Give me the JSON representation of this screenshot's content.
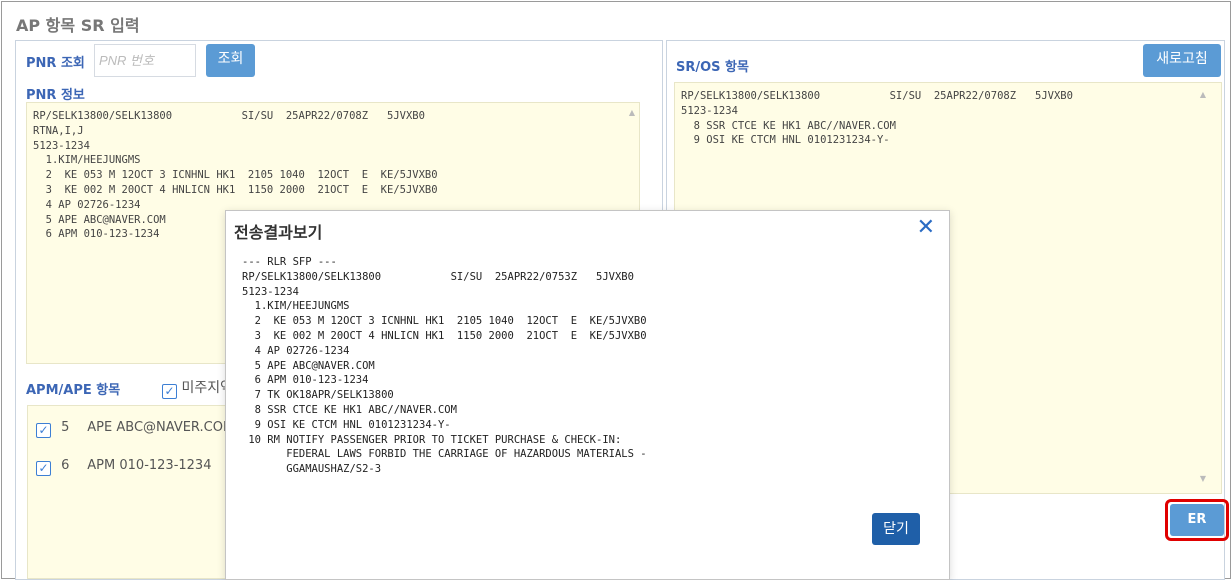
{
  "window": {
    "title": "AP 항목 SR 입력"
  },
  "pnr_search": {
    "label": "PNR 조회",
    "placeholder": "PNR 번호",
    "button": "조회"
  },
  "pnr_info": {
    "label": "PNR 정보",
    "text": "RP/SELK13800/SELK13800           SI/SU  25APR22/0708Z   5JVXB0\nRTNA,I,J\n5123-1234\n  1.KIM/HEEJUNGMS\n  2  KE 053 M 12OCT 3 ICNHNL HK1  2105 1040  12OCT  E  KE/5JVXB0\n  3  KE 002 M 20OCT 4 HNLICN HK1  1150 2000  21OCT  E  KE/5JVXB0\n  4 AP 02726-1234\n  5 APE ABC@NAVER.COM\n  6 APM 010-123-1234"
  },
  "sr_os": {
    "label": "SR/OS 항목",
    "refresh_button": "새로고침",
    "text": "RP/SELK13800/SELK13800           SI/SU  25APR22/0708Z   5JVXB0\n5123-1234\n  8 SSR CTCE KE HK1 ABC//NAVER.COM\n  9 OSI KE CTCM HNL 0101231234-Y-"
  },
  "apm_ape": {
    "label": "APM/APE 항목",
    "checkbox_label": "미주지역",
    "items": [
      {
        "num": "5",
        "code": "APE",
        "value": "ABC@NAVER.COM",
        "checked": true
      },
      {
        "num": "6",
        "code": "APM",
        "value": "010-123-1234",
        "checked": true
      }
    ]
  },
  "er_button": "ER",
  "dialog": {
    "title": "전송결과보기",
    "close_icon": "close-icon",
    "body": "--- RLR SFP ---\nRP/SELK13800/SELK13800           SI/SU  25APR22/0753Z   5JVXB0\n5123-1234\n  1.KIM/HEEJUNGMS\n  2  KE 053 M 12OCT 3 ICNHNL HK1  2105 1040  12OCT  E  KE/5JVXB0\n  3  KE 002 M 20OCT 4 HNLICN HK1  1150 2000  21OCT  E  KE/5JVXB0\n  4 AP 02726-1234\n  5 APE ABC@NAVER.COM\n  6 APM 010-123-1234\n  7 TK OK18APR/SELK13800\n  8 SSR CTCE KE HK1 ABC//NAVER.COM\n  9 OSI KE CTCM HNL 0101231234-Y-\n 10 RM NOTIFY PASSENGER PRIOR TO TICKET PURCHASE & CHECK-IN:\n       FEDERAL LAWS FORBID THE CARRIAGE OF HAZARDOUS MATERIALS -\n       GGAMAUSHAZ/S2-3",
    "close_button": "닫기"
  },
  "colors": {
    "accent": "#3c66b5",
    "button": "#5b9bd5",
    "button_dark": "#1f5fa8",
    "memo_bg": "#fffde6",
    "highlight": "#e00000"
  }
}
